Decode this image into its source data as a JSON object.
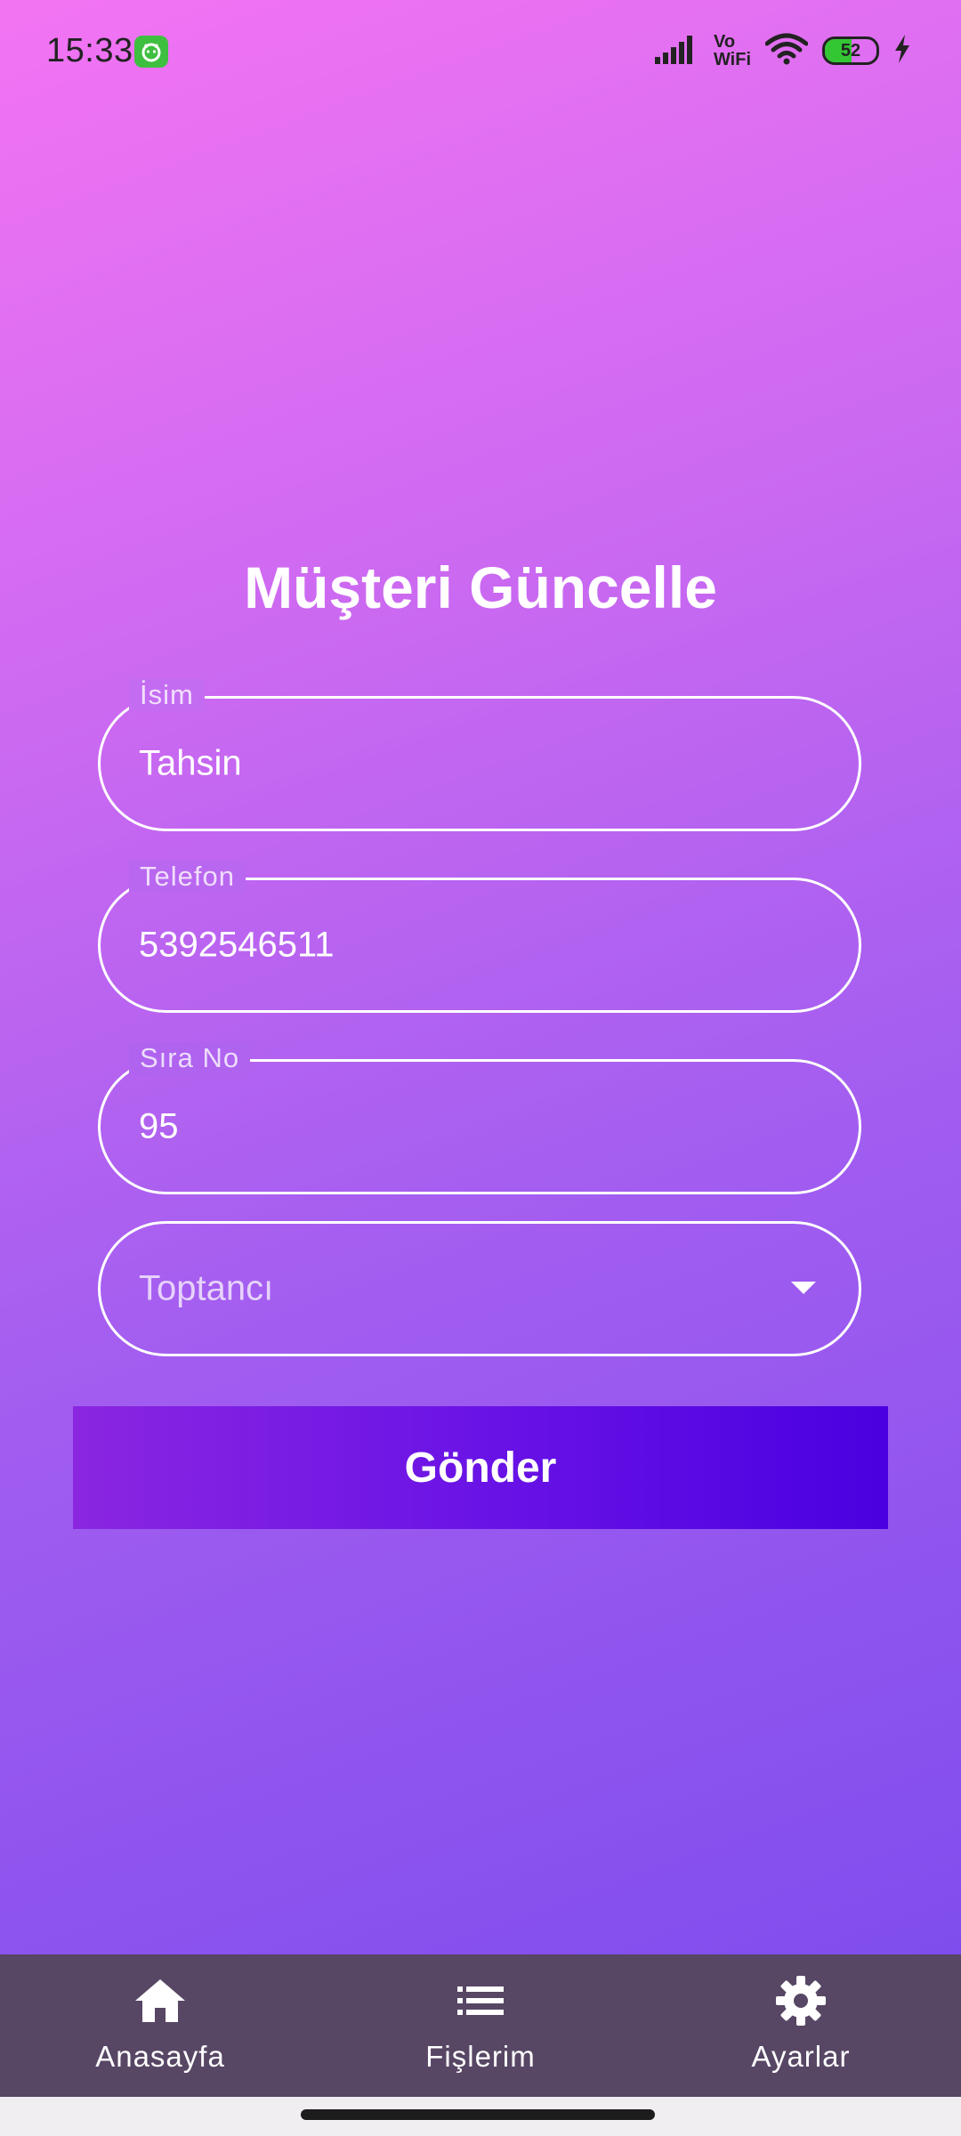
{
  "status_bar": {
    "time": "15:33",
    "network_icon": "signal-icon",
    "volte_line1": "Vo",
    "volte_line2": "WiFi",
    "battery_level": "52",
    "battery_fraction": 0.52
  },
  "form": {
    "title": "Müşteri Güncelle",
    "name_field": {
      "label": "İsim",
      "value": "Tahsin"
    },
    "phone_field": {
      "label": "Telefon",
      "value": "5392546511"
    },
    "order_field": {
      "label": "Sıra No",
      "value": "95"
    },
    "wholesaler_select": {
      "placeholder": "Toptancı"
    },
    "submit_label": "Gönder"
  },
  "bottom_nav": {
    "items": [
      {
        "label": "Anasayfa",
        "icon": "home-icon"
      },
      {
        "label": "Fişlerim",
        "icon": "list-icon"
      },
      {
        "label": "Ayarlar",
        "icon": "gear-icon"
      }
    ]
  },
  "colors": {
    "gradient_top": "#f374f3",
    "gradient_bottom": "#7f4ded",
    "button_start": "#8a26e0",
    "button_end": "#4a00e0",
    "nav_background": "#574664"
  }
}
